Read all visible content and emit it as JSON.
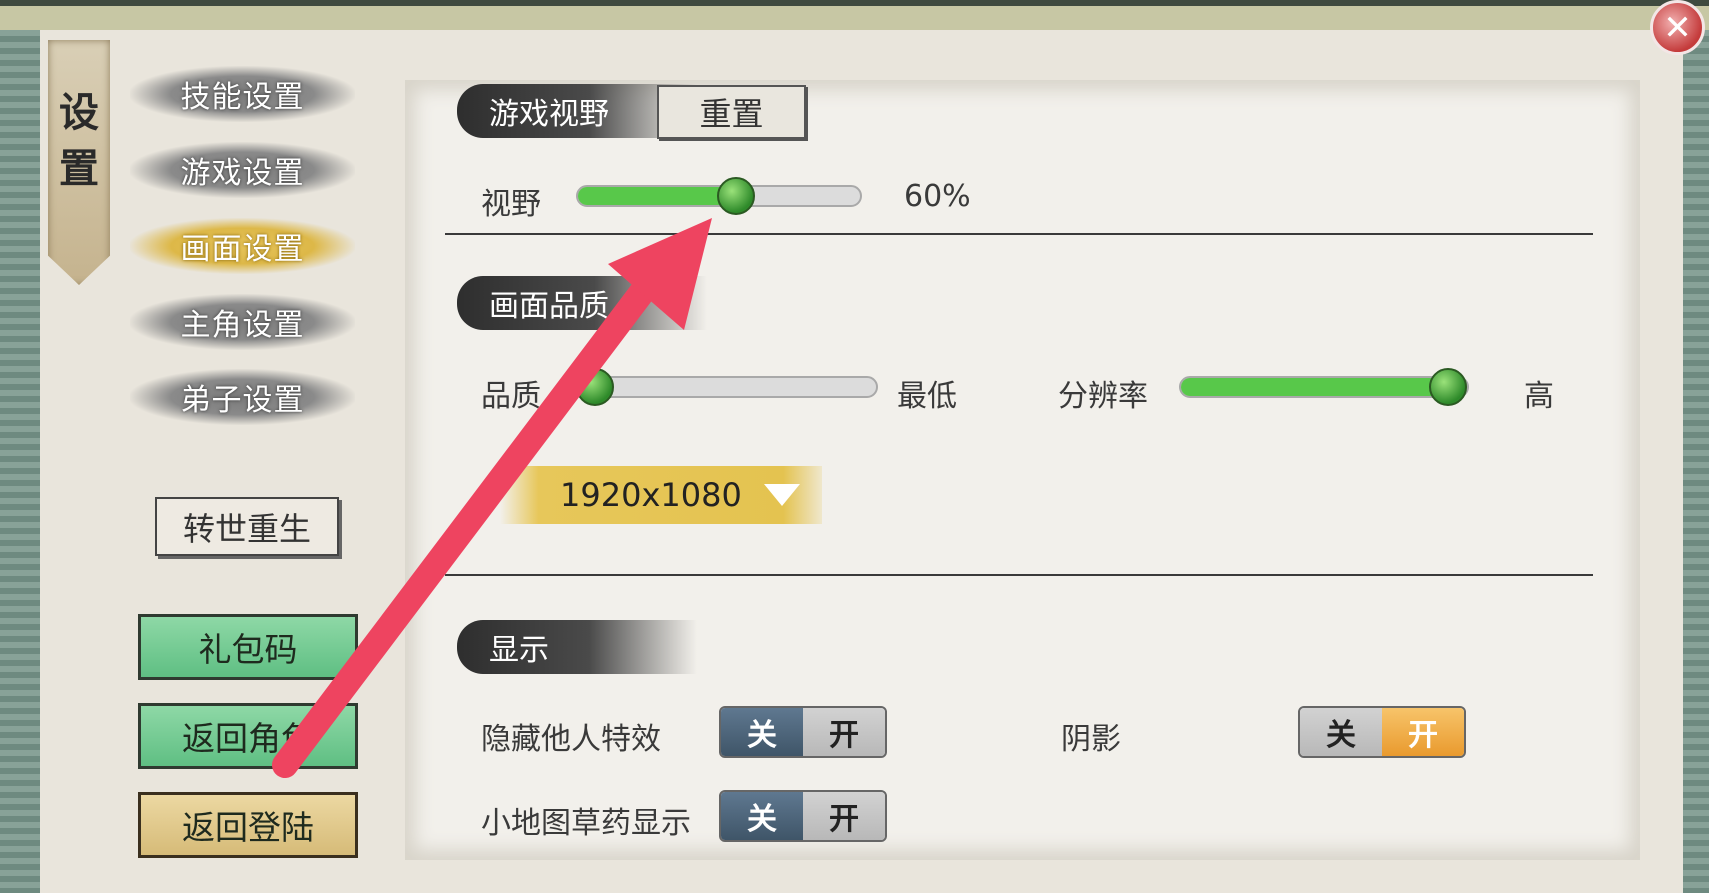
{
  "banner": {
    "title": "设置"
  },
  "close": {
    "glyph": "✕"
  },
  "menu": {
    "items": [
      {
        "label": "技能设置",
        "active": false
      },
      {
        "label": "游戏设置",
        "active": false
      },
      {
        "label": "画面设置",
        "active": true
      },
      {
        "label": "主角设置",
        "active": false
      },
      {
        "label": "弟子设置",
        "active": false
      }
    ],
    "rebirth_label": "转世重生",
    "gift_code_label": "礼包码",
    "back_to_role_label": "返回角色",
    "back_to_login_label": "返回登陆"
  },
  "view_section": {
    "title": "游戏视野",
    "reset_label": "重置",
    "fov_label": "视野",
    "fov_value_text": "60%",
    "fov_fraction": 0.6
  },
  "quality_section": {
    "title": "画面品质",
    "quality_label": "品质",
    "quality_value_text": "最低",
    "quality_fraction": 0.0,
    "resolution_label": "分辨率",
    "resolution_value_text": "高",
    "resolution_fraction": 1.0,
    "resolution_select": "1920x1080"
  },
  "display_section": {
    "title": "显示",
    "hide_others_effects_label": "隐藏他人特效",
    "shadow_label": "阴影",
    "minimap_herbs_label": "小地图草药显示",
    "off_label": "关",
    "on_label": "开",
    "hide_others_effects": "off",
    "shadow": "on",
    "minimap_herbs": "off"
  },
  "colors": {
    "slider_fill": "#58c84a",
    "active_menu": "#e2be4f",
    "annotation_arrow": "#ee4460"
  }
}
